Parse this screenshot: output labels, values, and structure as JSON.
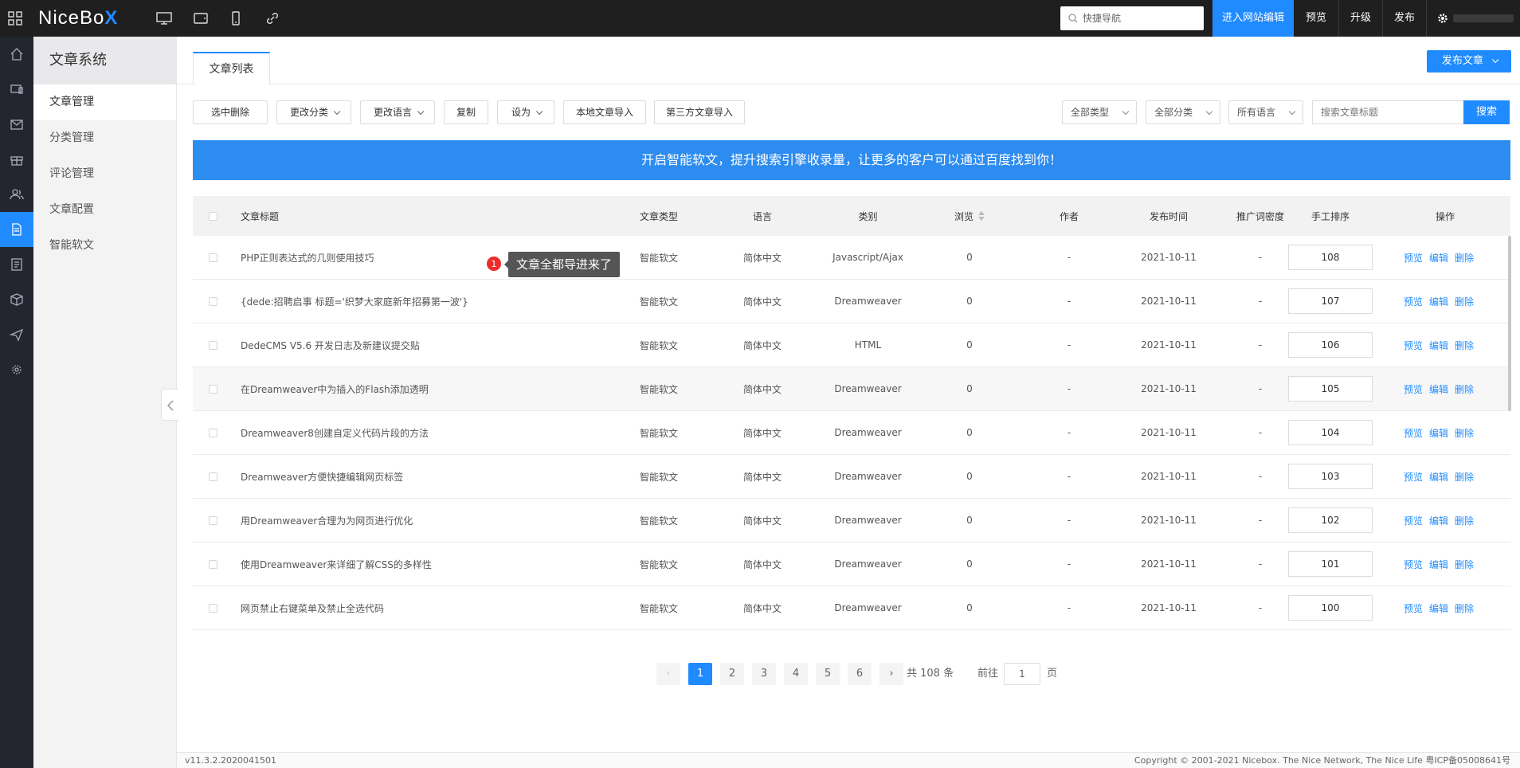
{
  "topbar": {
    "logo_text": "NiceBo",
    "logo_x": "X",
    "quick_search_placeholder": "快捷导航",
    "enter_editor": "进入网站编辑",
    "preview": "预览",
    "upgrade": "升级",
    "publish": "发布"
  },
  "sidenav": {
    "title": "文章系统",
    "items": [
      "文章管理",
      "分类管理",
      "评论管理",
      "文章配置",
      "智能软文"
    ]
  },
  "tabs": {
    "article_list": "文章列表"
  },
  "publish_article": "发布文章",
  "toolbar": {
    "delete_selected": "选中删除",
    "change_category": "更改分类",
    "change_language": "更改语言",
    "copy": "复制",
    "set_as": "设为",
    "local_import": "本地文章导入",
    "third_party_import": "第三方文章导入"
  },
  "filters": {
    "type": "全部类型",
    "category": "全部分类",
    "language": "所有语言",
    "search_placeholder": "搜索文章标题",
    "search_button": "搜索"
  },
  "banner": "开启智能软文，提升搜索引擎收录量，让更多的客户可以通过百度找到你！",
  "tooltip": {
    "badge": "1",
    "text": "文章全都导进来了"
  },
  "table": {
    "headers": {
      "title": "文章标题",
      "type": "文章类型",
      "language": "语言",
      "category": "类别",
      "views": "浏览",
      "author": "作者",
      "date": "发布时间",
      "density": "推广词密度",
      "sort": "手工排序",
      "ops": "操作"
    },
    "op_labels": {
      "preview": "预览",
      "edit": "编辑",
      "delete": "删除"
    },
    "rows": [
      {
        "title": "PHP正则表达式的几则使用技巧",
        "type": "智能软文",
        "lang": "简体中文",
        "cat": "Javascript/Ajax",
        "views": "0",
        "author": "-",
        "date": "2021-10-11",
        "density": "-",
        "sort": "108"
      },
      {
        "title": "{dede:招聘启事 标题='织梦大家庭新年招募第一波'}",
        "type": "智能软文",
        "lang": "简体中文",
        "cat": "Dreamweaver",
        "views": "0",
        "author": "-",
        "date": "2021-10-11",
        "density": "-",
        "sort": "107"
      },
      {
        "title": "DedeCMS V5.6 开发日志及新建议提交贴",
        "type": "智能软文",
        "lang": "简体中文",
        "cat": "HTML",
        "views": "0",
        "author": "-",
        "date": "2021-10-11",
        "density": "-",
        "sort": "106"
      },
      {
        "title": "在Dreamweaver中为插入的Flash添加透明",
        "type": "智能软文",
        "lang": "简体中文",
        "cat": "Dreamweaver",
        "views": "0",
        "author": "-",
        "date": "2021-10-11",
        "density": "-",
        "sort": "105"
      },
      {
        "title": "Dreamweaver8创建自定义代码片段的方法",
        "type": "智能软文",
        "lang": "简体中文",
        "cat": "Dreamweaver",
        "views": "0",
        "author": "-",
        "date": "2021-10-11",
        "density": "-",
        "sort": "104"
      },
      {
        "title": "Dreamweaver方便快捷编辑网页标签",
        "type": "智能软文",
        "lang": "简体中文",
        "cat": "Dreamweaver",
        "views": "0",
        "author": "-",
        "date": "2021-10-11",
        "density": "-",
        "sort": "103"
      },
      {
        "title": "用Dreamweaver合理为为网页进行优化",
        "type": "智能软文",
        "lang": "简体中文",
        "cat": "Dreamweaver",
        "views": "0",
        "author": "-",
        "date": "2021-10-11",
        "density": "-",
        "sort": "102"
      },
      {
        "title": "使用Dreamweaver来详细了解CSS的多样性",
        "type": "智能软文",
        "lang": "简体中文",
        "cat": "Dreamweaver",
        "views": "0",
        "author": "-",
        "date": "2021-10-11",
        "density": "-",
        "sort": "101"
      },
      {
        "title": "网页禁止右键菜单及禁止全选代码",
        "type": "智能软文",
        "lang": "简体中文",
        "cat": "Dreamweaver",
        "views": "0",
        "author": "-",
        "date": "2021-10-11",
        "density": "-",
        "sort": "100"
      }
    ]
  },
  "pagination": {
    "prev": "‹",
    "next": "›",
    "pages": [
      "1",
      "2",
      "3",
      "4",
      "5",
      "6"
    ],
    "total": "共 108 条",
    "goto": "前往",
    "goto_value": "1",
    "page_unit": "页"
  },
  "footer": {
    "version": "v11.3.2.2020041501",
    "copyright": "Copyright © 2001-2021 Nicebox. The Nice Network, The Nice Life   粤ICP备05008641号"
  },
  "colors": {
    "accent": "#1f8bff",
    "topbar": "#1f1f1f",
    "iconbar": "#23262e"
  }
}
